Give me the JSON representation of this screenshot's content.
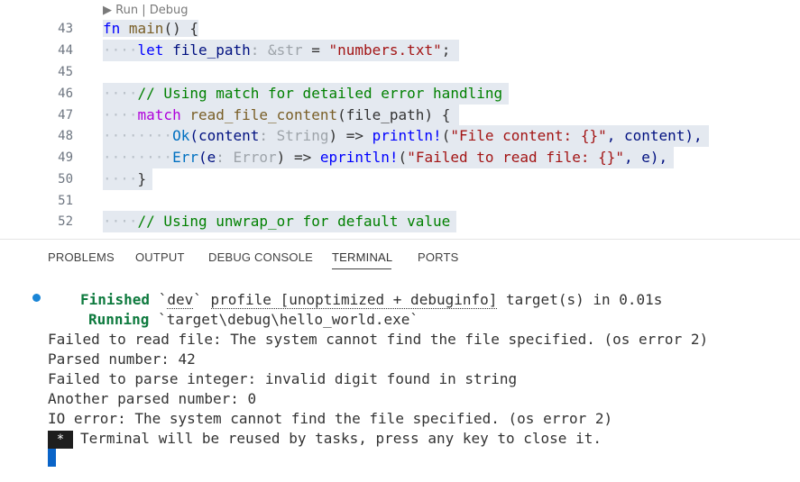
{
  "editor": {
    "codelens": "▶ Run | Debug",
    "lines": [
      {
        "num": "43"
      },
      {
        "num": "44"
      },
      {
        "num": "45"
      },
      {
        "num": "46"
      },
      {
        "num": "47"
      },
      {
        "num": "48"
      },
      {
        "num": "49"
      },
      {
        "num": "50"
      },
      {
        "num": "51"
      },
      {
        "num": "52"
      }
    ],
    "tokens": {
      "fn_kw": "fn",
      "main": "main",
      "main_rest": "() {",
      "let": "let",
      "file_path": "file_path",
      "colon_str": ": &str",
      "eq": " = ",
      "numbers_txt": "\"numbers.txt\"",
      "semi": ";",
      "comment1": "// Using match for detailed error handling",
      "match": "match",
      "read_fn": "read_file_content",
      "read_args": "(file_path) {",
      "ok": "Ok",
      "content": "(content",
      "colon_string": ": String",
      "ok_close": ") => ",
      "println": "println!",
      "ok_fmt_open": "(",
      "ok_fmt": "\"File content: {}\"",
      "ok_fmt_tail": ", content),",
      "err": "Err",
      "e_arg": "(e",
      "colon_error": ": Error",
      "err_close": ") => ",
      "eprintln": "eprintln!",
      "err_fmt_open": "(",
      "err_fmt": "\"Failed to read file: {}\"",
      "err_fmt_tail": ", e),",
      "close_brace": "}",
      "comment2": "// Using unwrap_or for default value"
    }
  },
  "panel": {
    "tabs": [
      {
        "label": "PROBLEMS"
      },
      {
        "label": "OUTPUT"
      },
      {
        "label": "DEBUG CONSOLE"
      },
      {
        "label": "TERMINAL"
      },
      {
        "label": "PORTS"
      }
    ],
    "active_tab": "TERMINAL"
  },
  "terminal": {
    "finished_word": "Finished",
    "finished_rest_a": " `",
    "finished_dev": "dev",
    "finished_rest_b": "` ",
    "finished_profile": "profile [unoptimized + debuginfo]",
    "finished_rest_c": " target(s) in 0.01s",
    "running_word": "Running",
    "running_rest": " `target\\debug\\hello_world.exe`",
    "out1": "Failed to read file: The system cannot find the file specified. (os error 2)",
    "out2": "Parsed number: 42",
    "out3": "Failed to parse integer: invalid digit found in string",
    "out4": "Another parsed number: 0",
    "out5": "IO error: The system cannot find the file specified. (os error 2)",
    "star": "*",
    "reuse_msg": "Terminal will be reused by tasks, press any key to close it."
  },
  "colors": {
    "accent": "#1a85d6",
    "terminal_green": "#0e7a3e",
    "selection": "#e4e9f0"
  }
}
